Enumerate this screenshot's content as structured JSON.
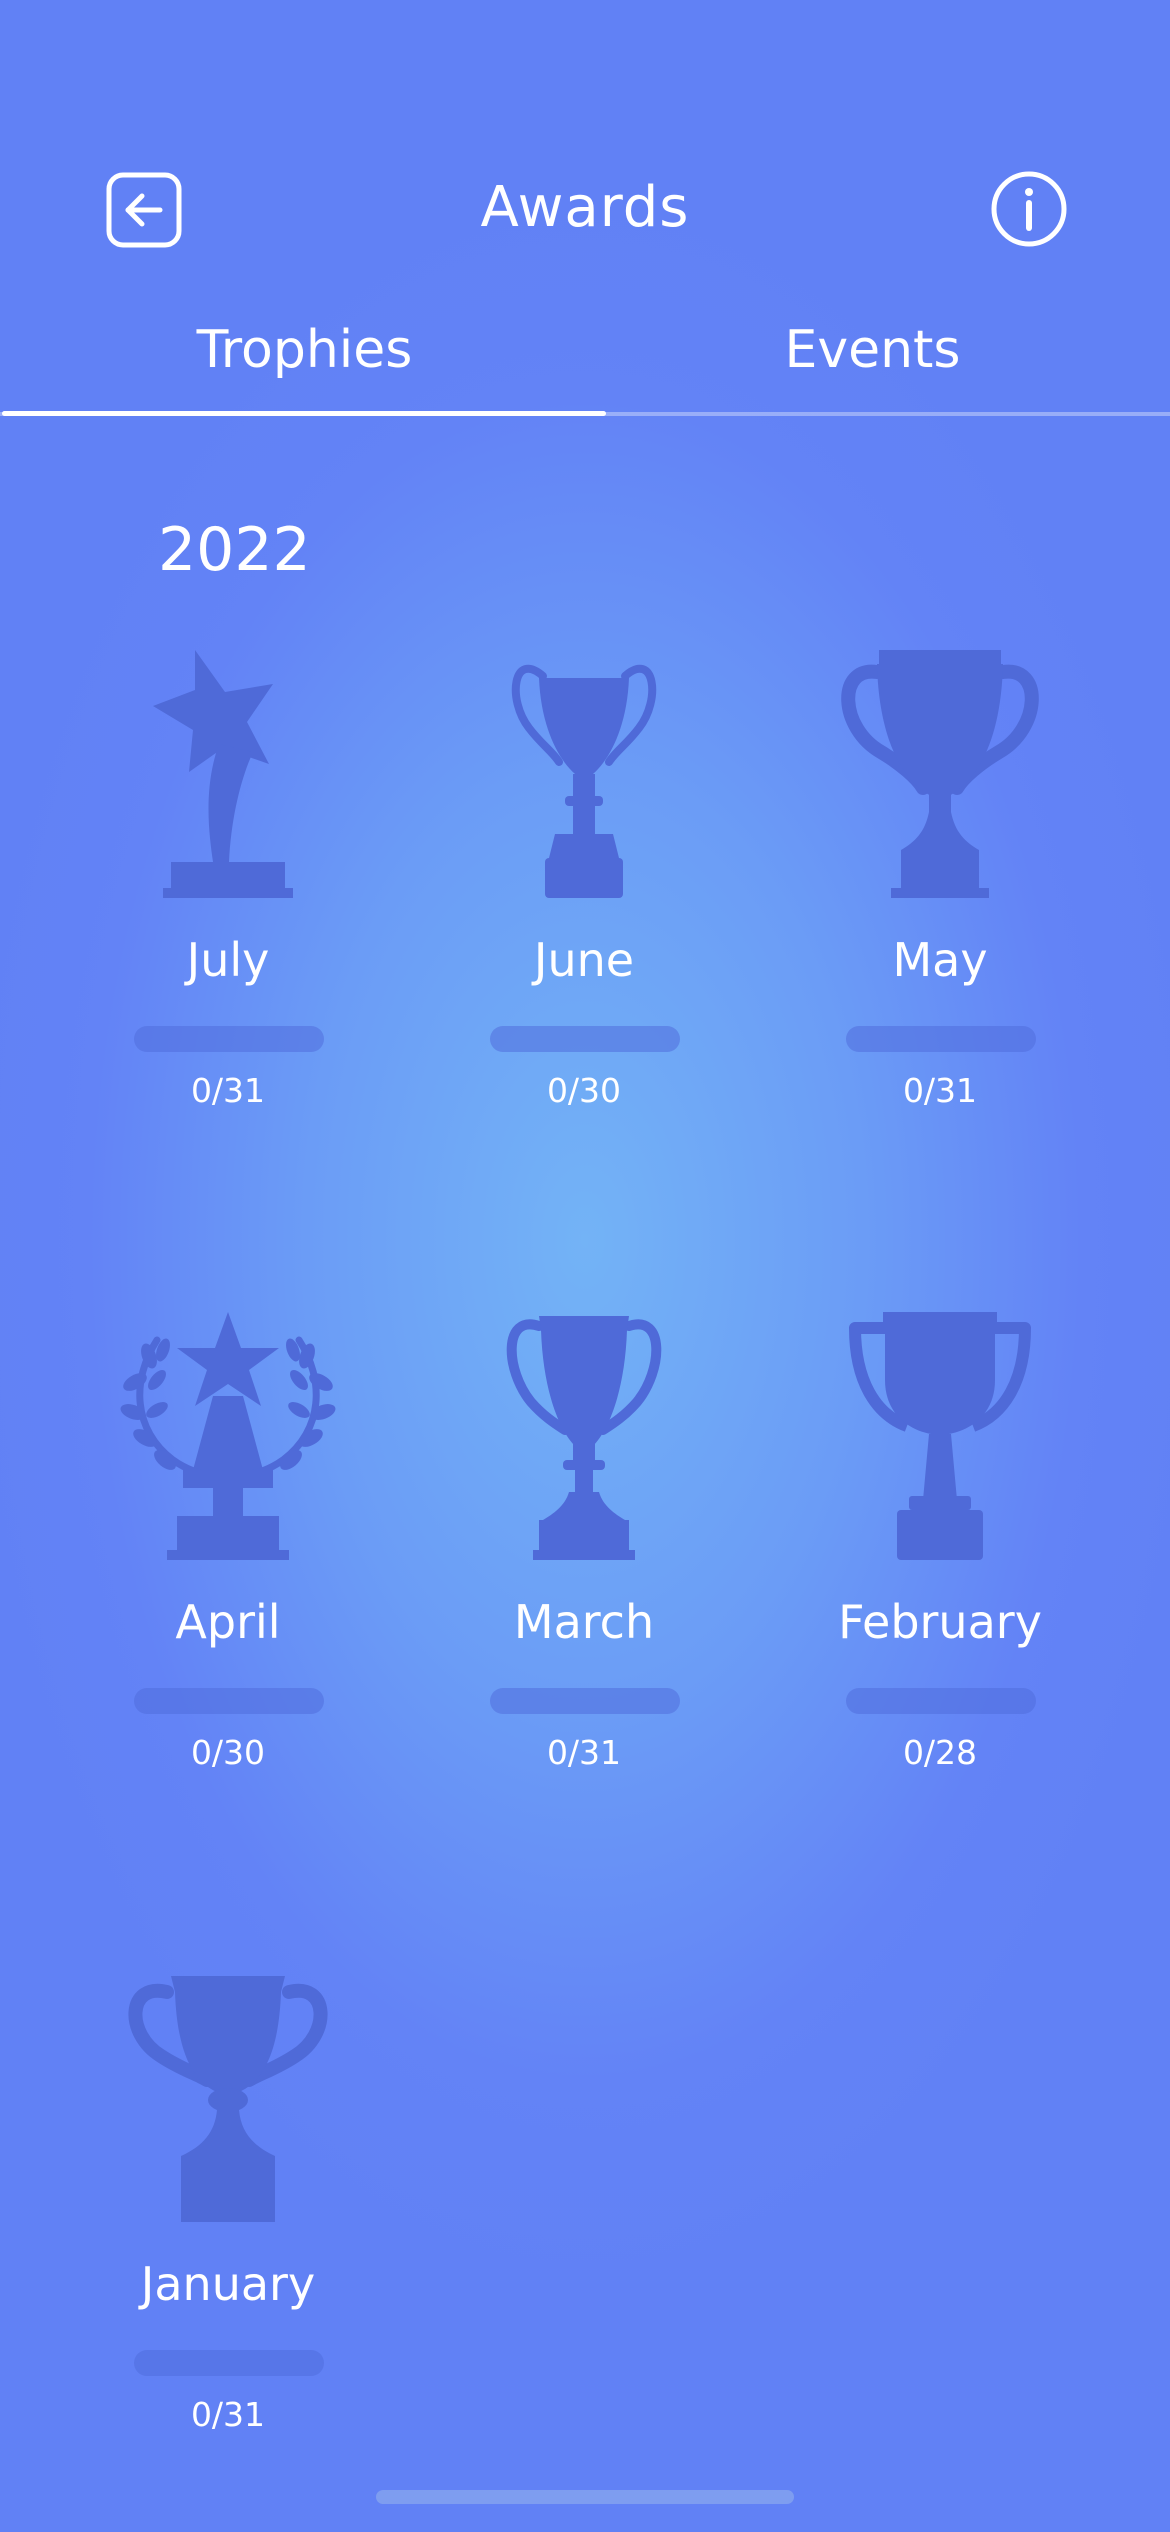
{
  "header": {
    "title": "Awards",
    "back_icon": "back-arrow-icon",
    "info_icon": "info-icon"
  },
  "tabs": [
    {
      "label": "Trophies",
      "active": true
    },
    {
      "label": "Events",
      "active": false
    }
  ],
  "year": "2022",
  "trophies": [
    {
      "month": "July",
      "count": "0/31",
      "progress": 0,
      "icon": "star-trophy-icon"
    },
    {
      "month": "June",
      "count": "0/30",
      "progress": 0,
      "icon": "cup-trophy-icon"
    },
    {
      "month": "May",
      "count": "0/31",
      "progress": 0,
      "icon": "cup-trophy-icon"
    },
    {
      "month": "April",
      "count": "0/30",
      "progress": 0,
      "icon": "laurel-star-trophy-icon"
    },
    {
      "month": "March",
      "count": "0/31",
      "progress": 0,
      "icon": "cup-trophy-icon"
    },
    {
      "month": "February",
      "count": "0/28",
      "progress": 0,
      "icon": "cup-trophy-icon"
    },
    {
      "month": "January",
      "count": "0/31",
      "progress": 0,
      "icon": "cup-trophy-icon"
    }
  ],
  "colors": {
    "background": "#6383f6",
    "background_center": "#73b3f6",
    "trophy_silhouette": "#4f6ad8",
    "text": "#ffffff"
  }
}
